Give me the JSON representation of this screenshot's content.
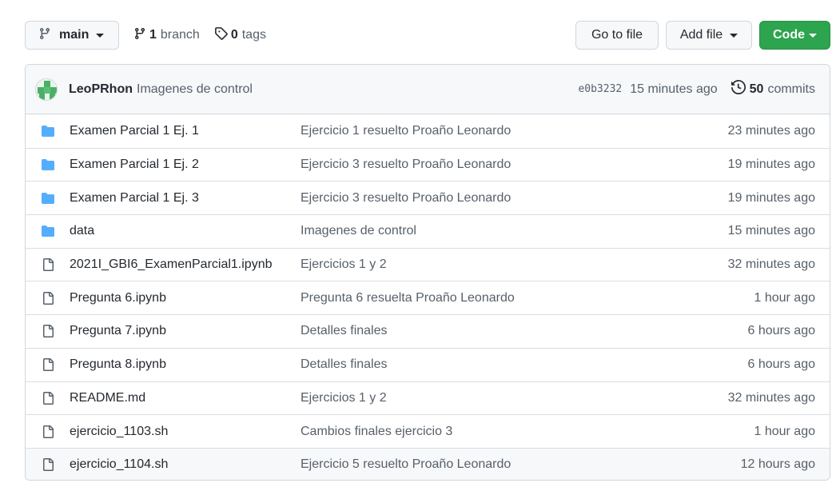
{
  "toolbar": {
    "branch": "main",
    "branches_count": "1",
    "branches_label": "branch",
    "tags_count": "0",
    "tags_label": "tags",
    "goto_label": "Go to file",
    "addfile_label": "Add file",
    "code_label": "Code",
    "code_color": "#2da44e"
  },
  "commit": {
    "author": "LeoPRhon",
    "message": "Imagenes de control",
    "sha": "e0b3232",
    "time": "15 minutes ago",
    "commits_count": "50",
    "commits_label": "commits"
  },
  "files": [
    {
      "type": "folder",
      "name": "Examen Parcial 1 Ej. 1",
      "message": "Ejercicio 1 resuelto Proaño Leonardo",
      "time": "23 minutes ago"
    },
    {
      "type": "folder",
      "name": "Examen Parcial 1 Ej. 2",
      "message": "Ejercicio 3 resuelto Proaño Leonardo",
      "time": "19 minutes ago"
    },
    {
      "type": "folder",
      "name": "Examen Parcial 1 Ej. 3",
      "message": "Ejercicio 3 resuelto Proaño Leonardo",
      "time": "19 minutes ago"
    },
    {
      "type": "folder",
      "name": "data",
      "message": "Imagenes de control",
      "time": "15 minutes ago"
    },
    {
      "type": "file",
      "name": "2021I_GBI6_ExamenParcial1.ipynb",
      "message": "Ejercicios 1 y 2",
      "time": "32 minutes ago"
    },
    {
      "type": "file",
      "name": "Pregunta 6.ipynb",
      "message": "Pregunta 6 resuelta Proaño Leonardo",
      "time": "1 hour ago"
    },
    {
      "type": "file",
      "name": "Pregunta 7.ipynb",
      "message": "Detalles finales",
      "time": "6 hours ago"
    },
    {
      "type": "file",
      "name": "Pregunta 8.ipynb",
      "message": "Detalles finales",
      "time": "6 hours ago"
    },
    {
      "type": "file",
      "name": "README.md",
      "message": "Ejercicios 1 y 2",
      "time": "32 minutes ago"
    },
    {
      "type": "file",
      "name": "ejercicio_1103.sh",
      "message": "Cambios finales ejercicio 3",
      "time": "1 hour ago"
    },
    {
      "type": "file",
      "name": "ejercicio_1104.sh",
      "message": "Ejercicio 5 resuelto Proaño Leonardo",
      "time": "12 hours ago"
    }
  ]
}
